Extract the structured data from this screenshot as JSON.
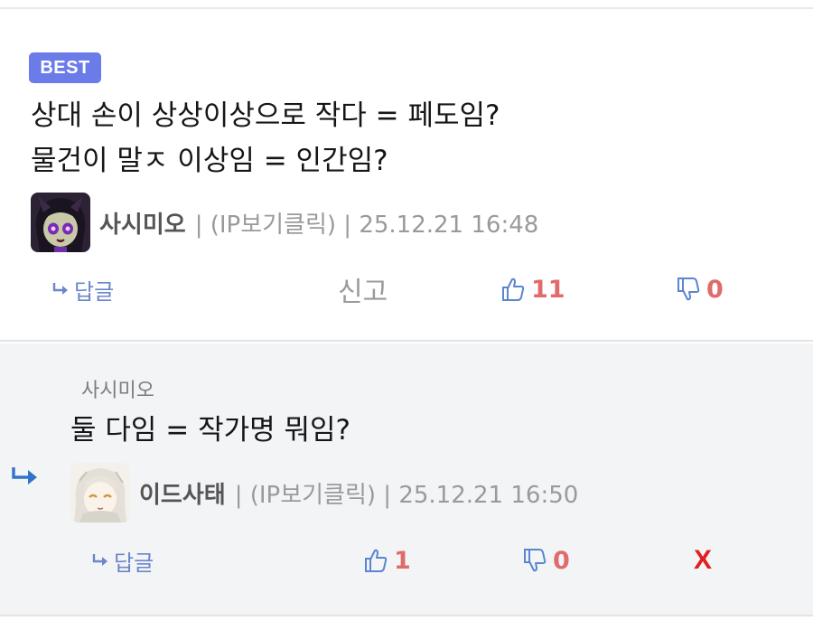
{
  "best_comment": {
    "badge": "BEST",
    "lines": [
      "상대 손이 상상이상으로 작다 = 페도임?",
      "물건이 말ㅈ 이상임 = 인간임?"
    ],
    "author": {
      "nickname": "사시미오",
      "meta": "| (IP보기클릭) | 25.12.21 16:48",
      "avatar_icon": "dark-hair-purple-eyes-avatar"
    },
    "actions": {
      "reply_label": "답글",
      "report_label": "신고",
      "upvotes": "11",
      "downvotes": "0"
    }
  },
  "reply_comment": {
    "parent_nickname": "사시미오",
    "text": "둘 다임 = 작가명 뭐임?",
    "author": {
      "nickname": "이드사태",
      "meta": "| (IP보기클릭) | 25.12.21 16:50",
      "avatar_icon": "white-hair-girl-avatar"
    },
    "actions": {
      "reply_label": "답글",
      "upvotes": "1",
      "downvotes": "0",
      "delete_label": "X"
    }
  },
  "colors": {
    "badge_bg": "#6b7ce8",
    "link_blue": "#6b86c9",
    "vote_red": "#e16a6a",
    "delete_red": "#e02020",
    "reply_bg": "#f3f4f6"
  }
}
